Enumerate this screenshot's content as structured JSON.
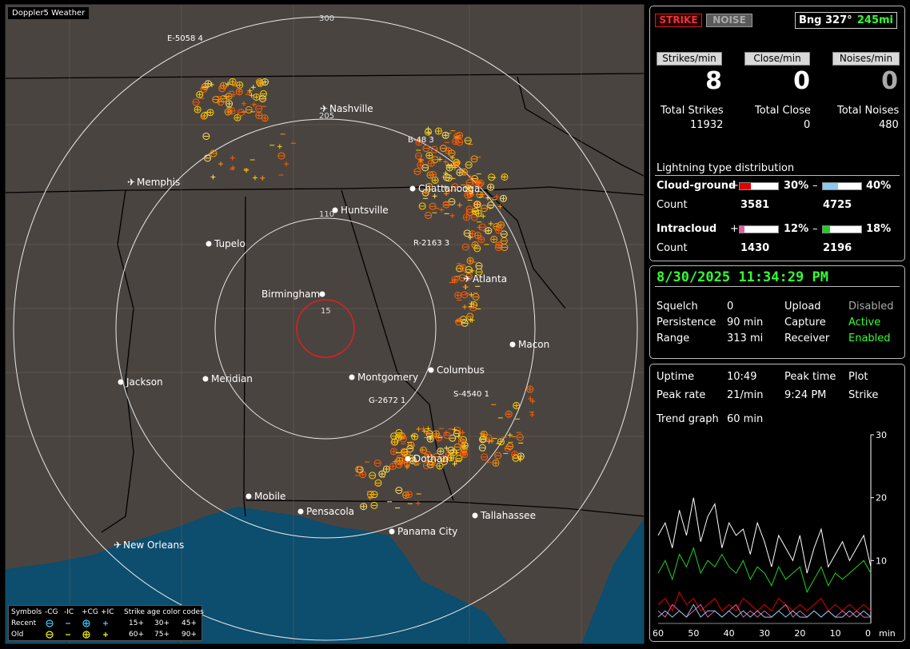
{
  "app_title": "Doppler5 Weather",
  "map": {
    "ring_labels": [
      "300",
      "205",
      "110",
      "15"
    ],
    "cities": [
      {
        "name": "Nashville",
        "type": "airport"
      },
      {
        "name": "Memphis",
        "type": "airport"
      },
      {
        "name": "Chattanooga",
        "type": "dot"
      },
      {
        "name": "Huntsville",
        "type": "dot"
      },
      {
        "name": "Tupelo",
        "type": "dot"
      },
      {
        "name": "Atlanta",
        "type": "airport"
      },
      {
        "name": "Birmingham",
        "type": "dot"
      },
      {
        "name": "Macon",
        "type": "dot"
      },
      {
        "name": "Jackson",
        "type": "dot"
      },
      {
        "name": "Meridian",
        "type": "dot"
      },
      {
        "name": "Montgomery",
        "type": "dot"
      },
      {
        "name": "Columbus",
        "type": "dot"
      },
      {
        "name": "Dothan",
        "type": "dot"
      },
      {
        "name": "Mobile",
        "type": "dot"
      },
      {
        "name": "Pensacola",
        "type": "dot"
      },
      {
        "name": "Tallahassee",
        "type": "dot"
      },
      {
        "name": "Panama City",
        "type": "dot"
      },
      {
        "name": "New Orleans",
        "type": "airport"
      }
    ],
    "storm_ids": [
      "E-5058 4",
      "B-48 3",
      "R-2163 3",
      "G-2672 1",
      "S-4540 1"
    ],
    "legend": {
      "header": "Symbols",
      "cols": [
        "-CG",
        "-IC",
        "+CG",
        "+IC"
      ],
      "age_title": "Strike age color codes",
      "recent_label": "Recent",
      "old_label": "Old",
      "recent_ages": [
        "15+",
        "30+",
        "45+"
      ],
      "old_ages": [
        "60+",
        "75+",
        "90+"
      ],
      "recent_colors": [
        "#ffd000",
        "#ff9a00",
        "#ff6a00"
      ],
      "old_colors": [
        "#ff5a00",
        "#ff3000",
        "#ff1000"
      ]
    }
  },
  "controls": {
    "strike_button": "STRIKE",
    "noise_button": "NOISE",
    "bearing_label": "Bng 327°",
    "range_value": "245mi"
  },
  "stats": {
    "strikes_per_min_label": "Strikes/min",
    "close_per_min_label": "Close/min",
    "noises_per_min_label": "Noises/min",
    "strikes_per_min": "8",
    "close_per_min": "0",
    "noises_per_min": "0",
    "total_strikes_label": "Total Strikes",
    "total_close_label": "Total Close",
    "total_noises_label": "Total Noises",
    "total_strikes": "11932",
    "total_close": "0",
    "total_noises": "480"
  },
  "distribution": {
    "title": "Lightning type distribution",
    "cloud_ground_label": "Cloud-ground",
    "intracloud_label": "Intracloud",
    "count_label": "Count",
    "plus_sign": "+",
    "minus_sign": "–",
    "cg_pos_pct": "30%",
    "cg_neg_pct": "40%",
    "ic_pos_pct": "12%",
    "ic_neg_pct": "18%",
    "cg_pos_fraction": 0.3,
    "cg_neg_fraction": 0.4,
    "ic_pos_fraction": 0.12,
    "ic_neg_fraction": 0.18,
    "cg_pos_count": "3581",
    "cg_neg_count": "4725",
    "ic_pos_count": "1430",
    "ic_neg_count": "2196",
    "colors": {
      "cg_pos": "#e00000",
      "cg_neg": "#8ec8f0",
      "ic_pos": "#e060a0",
      "ic_neg": "#20d020"
    }
  },
  "status": {
    "datetime": "8/30/2025 11:34:29 PM",
    "squelch_label": "Squelch",
    "squelch": "0",
    "persistence_label": "Persistence",
    "persistence": "90 min",
    "range_label": "Range",
    "range": "313 mi",
    "upload_label": "Upload",
    "upload": "Disabled",
    "capture_label": "Capture",
    "capture": "Active",
    "receiver_label": "Receiver",
    "receiver": "Enabled"
  },
  "trend": {
    "uptime_label": "Uptime",
    "uptime": "10:49",
    "peak_time_label": "Peak time",
    "peak_time": "9:24 PM",
    "plot_label": "Plot",
    "plot": "Strike",
    "peak_rate_label": "Peak rate",
    "peak_rate": "21/min",
    "trend_label": "Trend graph",
    "trend_window": "60 min",
    "x_ticks": [
      "60",
      "50",
      "40",
      "30",
      "20",
      "10",
      "0"
    ],
    "x_unit": "min",
    "y_ticks": [
      "30",
      "20",
      "10"
    ]
  },
  "chart_data": {
    "type": "line",
    "xlabel": "min",
    "ylabel": "",
    "xlim": [
      60,
      0
    ],
    "ylim": [
      0,
      30
    ],
    "x": [
      60,
      58,
      56,
      54,
      52,
      50,
      48,
      46,
      44,
      42,
      40,
      38,
      36,
      34,
      32,
      30,
      28,
      26,
      24,
      22,
      20,
      18,
      16,
      14,
      12,
      10,
      8,
      6,
      4,
      2,
      0
    ],
    "series": [
      {
        "values": [
          14,
          16,
          12,
          18,
          14,
          20,
          13,
          17,
          19,
          12,
          16,
          14,
          15,
          11,
          16,
          13,
          9,
          14,
          12,
          10,
          14,
          8,
          12,
          15,
          9,
          11,
          13,
          10,
          12,
          14,
          9
        ],
        "color": "#ffffff"
      },
      {
        "values": [
          8,
          10,
          7,
          11,
          9,
          12,
          8,
          10,
          9,
          11,
          9,
          8,
          10,
          7,
          9,
          8,
          6,
          9,
          7,
          8,
          9,
          5,
          7,
          9,
          6,
          8,
          7,
          8,
          9,
          10,
          8
        ],
        "color": "#20d020"
      },
      {
        "values": [
          3,
          4,
          2,
          5,
          3,
          4,
          2,
          3,
          4,
          2,
          3,
          2,
          4,
          3,
          2,
          3,
          2,
          4,
          3,
          2,
          3,
          2,
          3,
          4,
          2,
          3,
          2,
          3,
          2,
          3,
          2
        ],
        "color": "#e00000"
      },
      {
        "values": [
          2,
          1,
          3,
          2,
          1,
          2,
          3,
          1,
          2,
          1,
          2,
          3,
          1,
          2,
          1,
          2,
          1,
          2,
          3,
          1,
          2,
          1,
          2,
          1,
          2,
          1,
          2,
          1,
          2,
          1,
          1
        ],
        "color": "#e060a0"
      },
      {
        "values": [
          1,
          2,
          1,
          2,
          1,
          3,
          1,
          2,
          2,
          1,
          2,
          1,
          2,
          1,
          2,
          1,
          1,
          2,
          1,
          2,
          1,
          1,
          2,
          1,
          2,
          1,
          1,
          2,
          1,
          2,
          1
        ],
        "color": "#8ec8f0"
      }
    ]
  }
}
